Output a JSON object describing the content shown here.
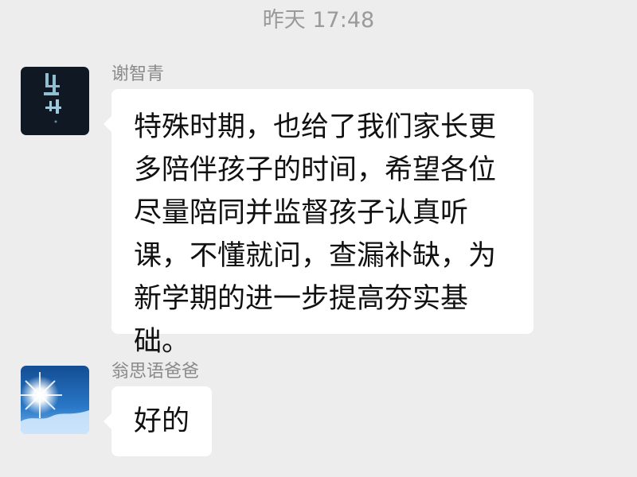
{
  "chat": {
    "timestamp": "昨天 17:48",
    "messages": [
      {
        "sender": "谢智青",
        "avatar_icon": "dark-calligraphy-avatar-icon",
        "text": "特殊时期，也给了我们家长更\n多陪伴孩子的时间，希望各位\n尽量陪同并监督孩子认真听\n课，不懂就问，查漏补缺，为\n新学期的进一步提高夯实基\n础。"
      },
      {
        "sender": "翁思语爸爸",
        "avatar_icon": "sun-sky-avatar-icon",
        "text": "好的"
      }
    ]
  },
  "colors": {
    "background": "#ededed",
    "bubble": "#ffffff",
    "meta_text": "#9a9a9a"
  }
}
